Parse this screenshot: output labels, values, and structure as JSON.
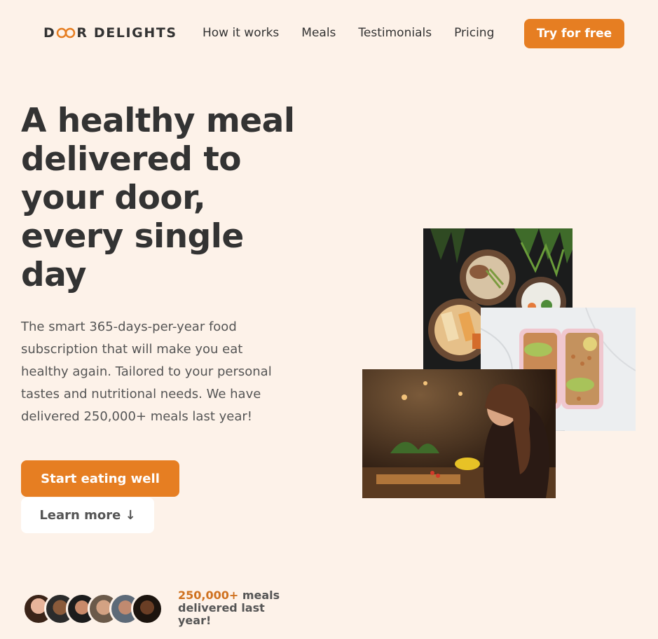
{
  "brand": {
    "logo_prefix": "D",
    "logo_middle": "OO",
    "logo_suffix": "R DELIGHTS"
  },
  "nav": {
    "links": [
      "How it works",
      "Meals",
      "Testimonials",
      "Pricing"
    ],
    "cta": "Try for free"
  },
  "hero": {
    "title": "A healthy meal delivered to your door, every single day",
    "description": "The smart 365-days-per-year food subscription that will make you eat healthy again. Tailored to your personal tastes and nutritional needs. We have delivered 250,000+ meals last year!",
    "primary_button": "Start eating well",
    "secondary_button": "Learn more ↓"
  },
  "delivered": {
    "number": "250,000+",
    "text": " meals delivered last year!"
  },
  "colors": {
    "background": "#fdf2e9",
    "accent": "#e67e22",
    "text": "#333333"
  },
  "images": [
    {
      "name": "food-bowls-image"
    },
    {
      "name": "meal-prep-image"
    },
    {
      "name": "woman-eating-image"
    }
  ],
  "avatars": [
    "customer-1",
    "customer-2",
    "customer-3",
    "customer-4",
    "customer-5",
    "customer-6"
  ]
}
